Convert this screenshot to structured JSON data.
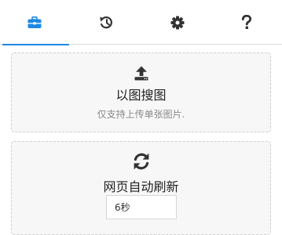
{
  "tabs": [
    {
      "icon": "toolbox-icon",
      "active": true
    },
    {
      "icon": "history-icon",
      "active": false
    },
    {
      "icon": "gear-icon",
      "active": false
    },
    {
      "icon": "question-icon",
      "active": false
    }
  ],
  "colors": {
    "accent": "#1e88e5",
    "icon": "#333333",
    "card_bg": "#f7f7f7",
    "card_border": "#cfcfcf",
    "subtitle": "#8a8a8a"
  },
  "image_search": {
    "icon": "upload-icon",
    "title": "以图搜图",
    "subtitle": "仅支持上传单张图片."
  },
  "auto_refresh": {
    "icon": "refresh-icon",
    "title": "网页自动刷新",
    "interval_value": "6秒"
  }
}
